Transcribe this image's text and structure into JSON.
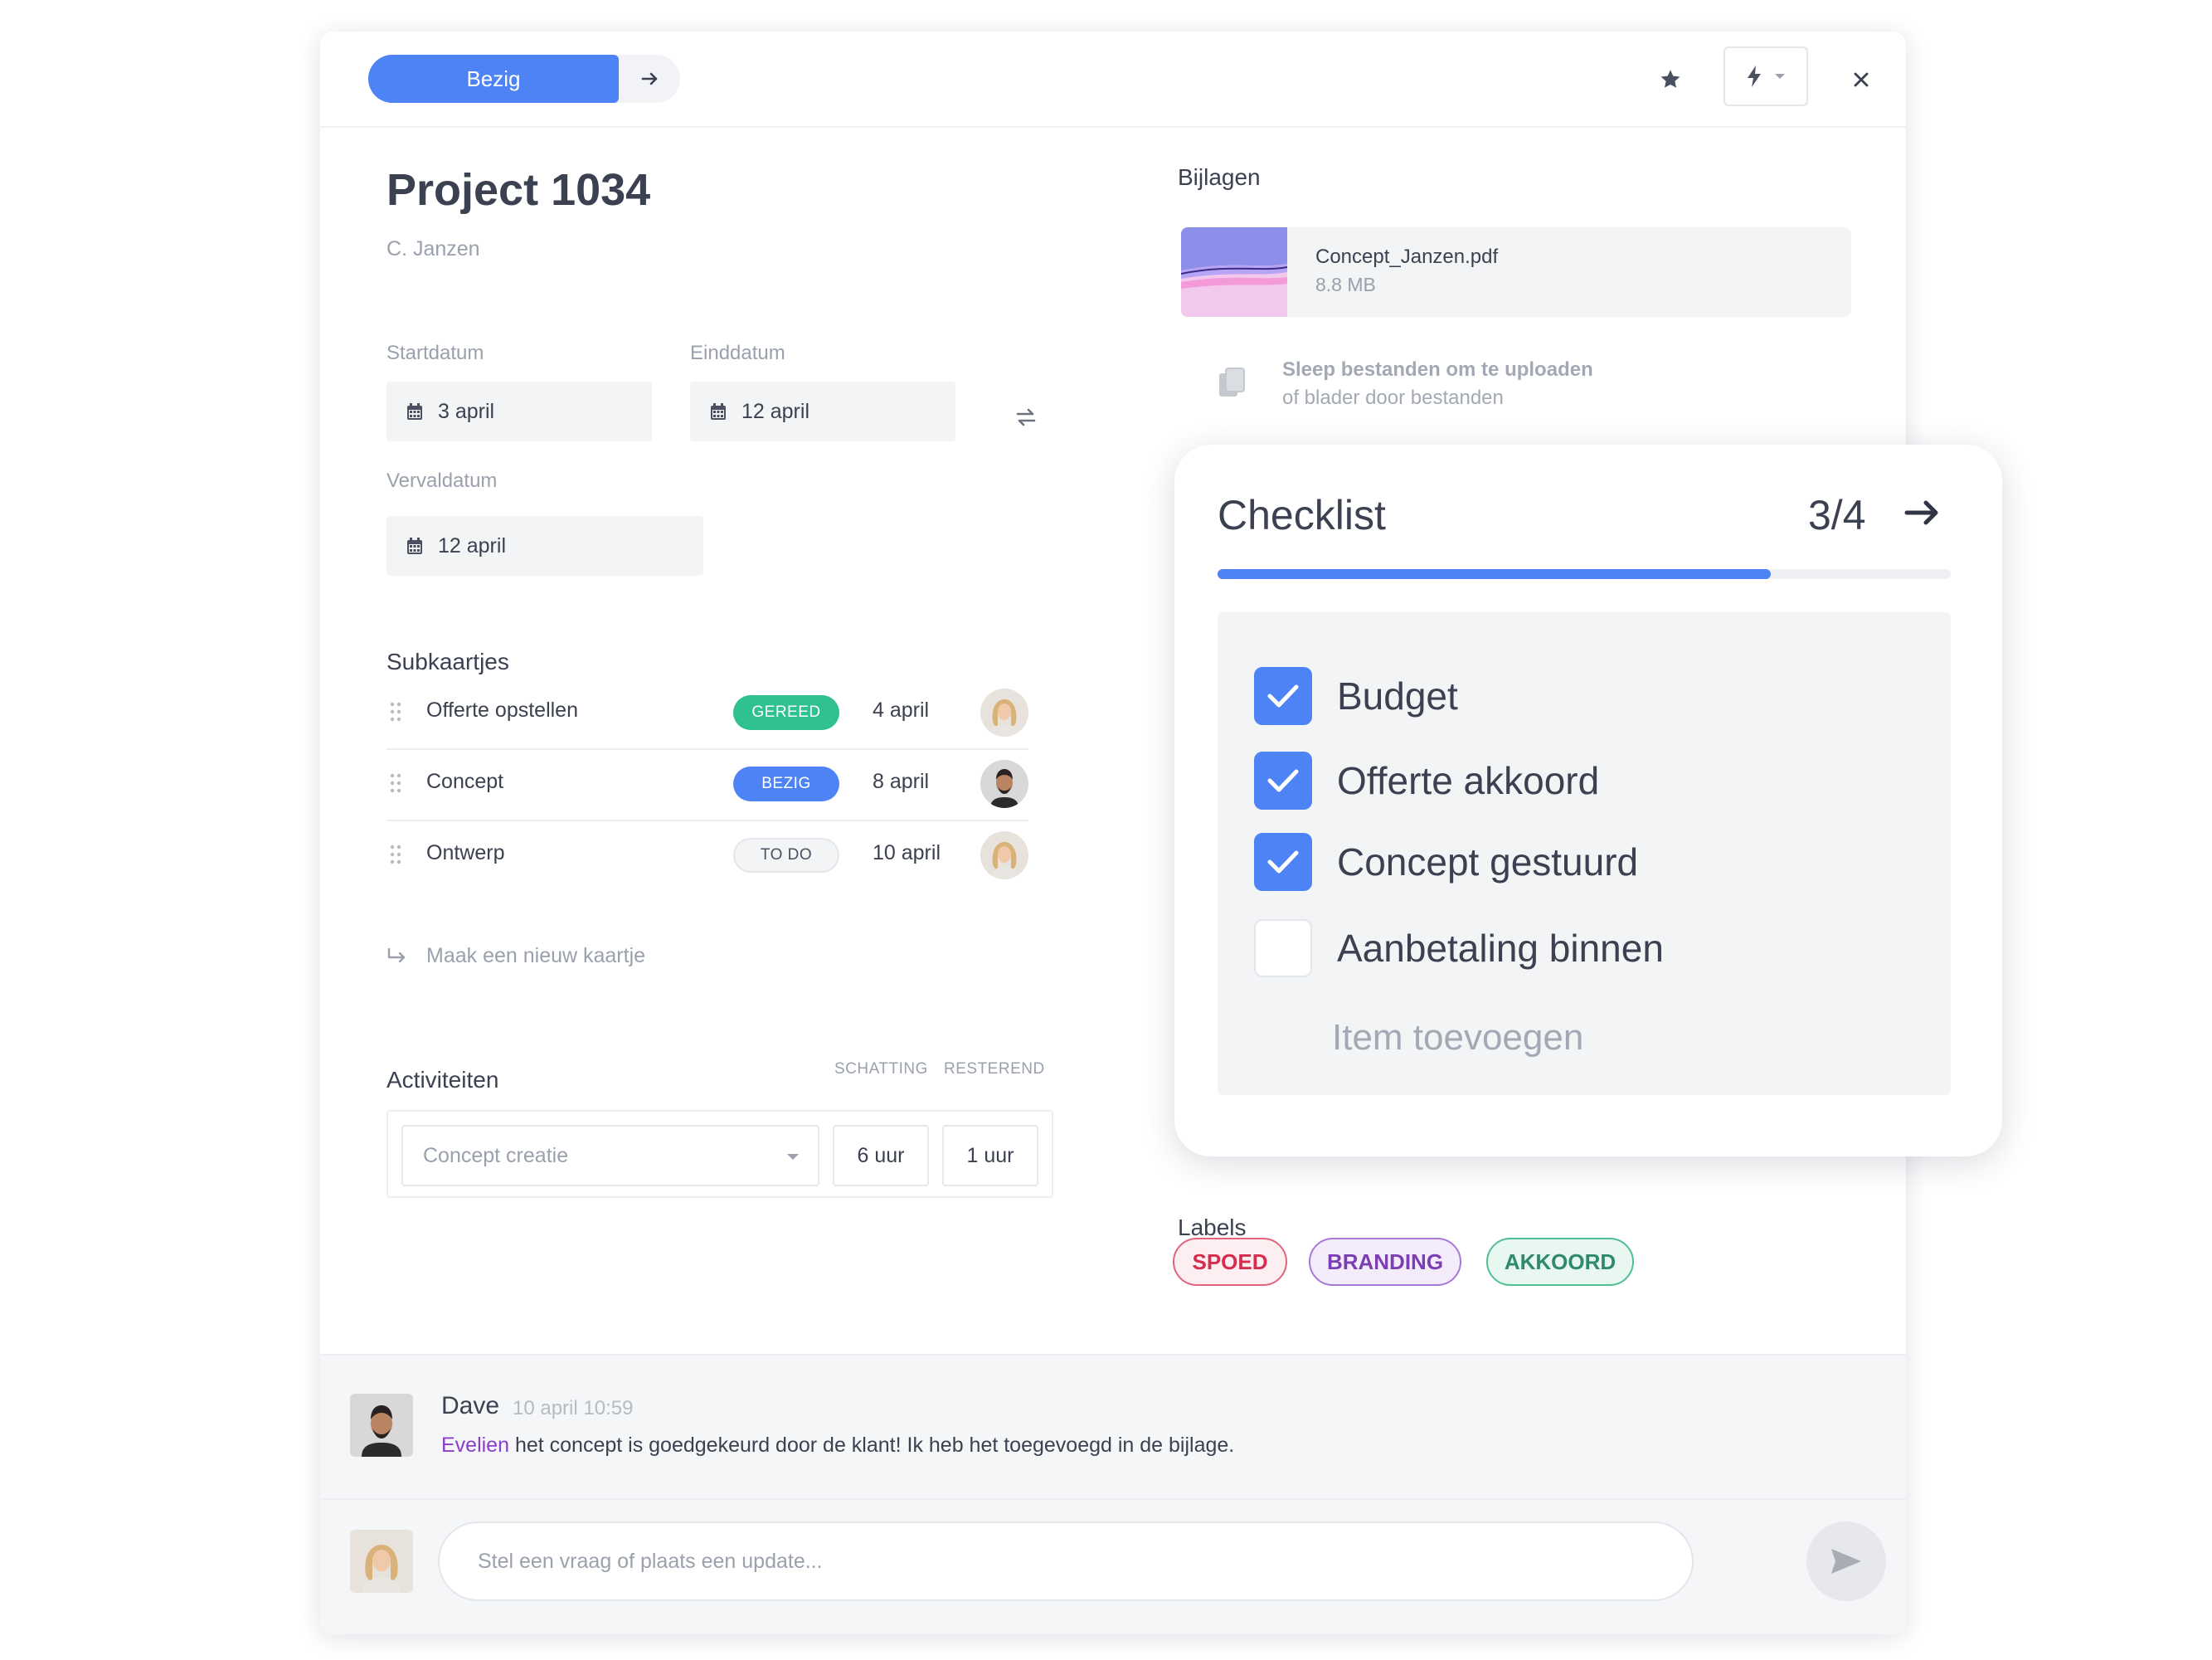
{
  "header": {
    "status_label": "Bezig",
    "status_next_icon": "arrow-right-icon",
    "favorite_icon": "star-icon",
    "automation_icon": "lightning-icon",
    "close_icon": "close-icon"
  },
  "project": {
    "title": "Project 1034",
    "owner": "C. Janzen"
  },
  "dates": {
    "start_label": "Startdatum",
    "start_value": "3 april",
    "end_label": "Einddatum",
    "end_value": "12 april",
    "due_label": "Vervaldatum",
    "due_value": "12 april"
  },
  "subcards": {
    "title": "Subkaartjes",
    "items": [
      {
        "name": "Offerte opstellen",
        "status": "GEREED",
        "date": "4 april"
      },
      {
        "name": "Concept",
        "status": "BEZIG",
        "date": "8 april"
      },
      {
        "name": "Ontwerp",
        "status": "TO DO",
        "date": "10 april"
      }
    ],
    "new_label": "Maak een nieuw kaartje"
  },
  "activities": {
    "title": "Activiteiten",
    "estimate_header": "SCHATTING",
    "remaining_header": "RESTEREND",
    "select_placeholder": "Concept creatie",
    "estimate": "6 uur",
    "remaining": "1 uur"
  },
  "attachments": {
    "title": "Bijlagen",
    "file_name": "Concept_Janzen.pdf",
    "file_size": "8.8 MB",
    "upload_title": "Sleep bestanden om te uploaden",
    "upload_sub": "of blader door bestanden"
  },
  "checklist": {
    "title": "Checklist",
    "count": "3/4",
    "progress": 0.755,
    "items": [
      {
        "label": "Budget",
        "checked": true
      },
      {
        "label": "Offerte akkoord",
        "checked": true
      },
      {
        "label": "Concept gestuurd",
        "checked": true
      },
      {
        "label": "Aanbetaling binnen",
        "checked": false
      }
    ],
    "add_label": "Item toevoegen"
  },
  "labels": {
    "title": "Labels",
    "items": [
      {
        "text": "SPOED",
        "color": "#d62c4e"
      },
      {
        "text": "BRANDING",
        "color": "#7b3fb3"
      },
      {
        "text": "AKKOORD",
        "color": "#2f8a6a"
      }
    ]
  },
  "comments": {
    "author": "Dave",
    "time": "10 april 10:59",
    "mention": "Evelien",
    "text": " het concept is goedgekeurd door de klant! Ik heb het toegevoegd in de bijlage.",
    "input_placeholder": "Stel een vraag of plaats een update...",
    "send_icon": "send-icon"
  },
  "colors": {
    "accent": "#4e83f5",
    "done": "#2fc28f"
  }
}
